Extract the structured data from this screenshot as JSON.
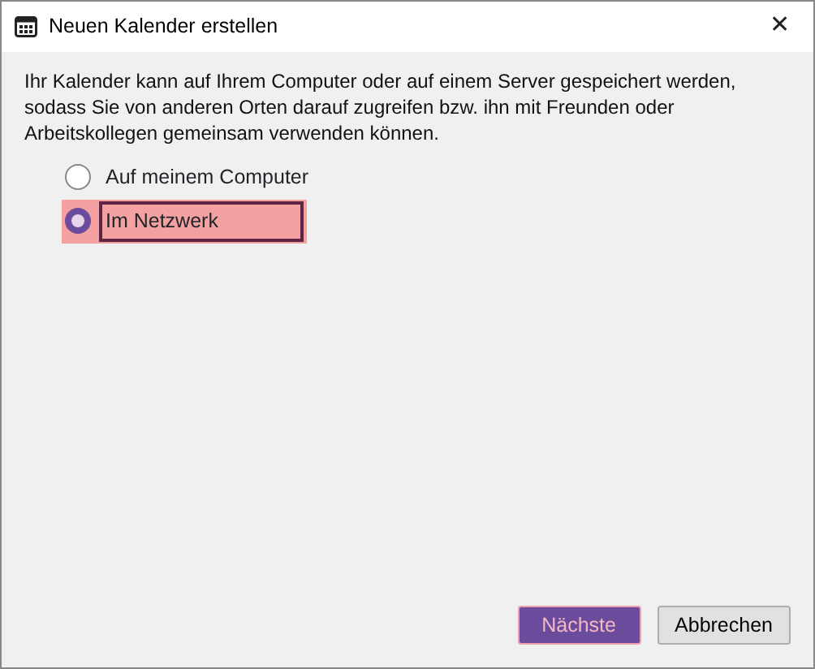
{
  "window": {
    "title": "Neuen Kalender erstellen",
    "close": "✕"
  },
  "description": "Ihr Kalender kann auf Ihrem Computer oder auf einem Server gespeichert werden, sodass Sie von anderen Orten darauf zugreifen bzw. ihn mit Freunden oder Arbeitskollegen gemeinsam verwenden können.",
  "options": [
    {
      "label": "Auf meinem Computer",
      "selected": false
    },
    {
      "label": "Im Netzwerk",
      "selected": true
    }
  ],
  "buttons": [
    {
      "label": "Nächste",
      "kind": "primary"
    },
    {
      "label": "Abbrechen",
      "kind": "secondary"
    }
  ]
}
